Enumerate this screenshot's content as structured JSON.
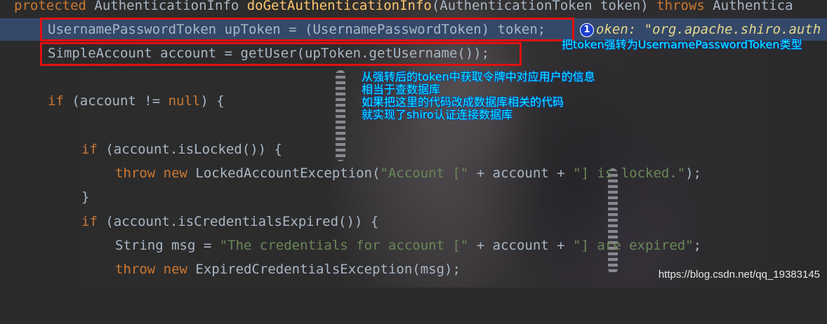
{
  "code": {
    "line0": {
      "kw": "protected",
      "type": " AuthenticationInfo ",
      "fn": "doGetAuthenticationInfo",
      "args": "(AuthenticationToken token) ",
      "throws": "throws",
      "rest": " Authentica"
    },
    "line1": {
      "text": "UsernamePasswordToken upToken = (UsernamePasswordToken) token;",
      "hint": "oken: \"org.apache.shiro.auth"
    },
    "line2": {
      "text": "SimpleAccount account = getUser(upToken.getUsername());"
    },
    "line4": {
      "kw": "if",
      "rest1": " (account != ",
      "kw2": "null",
      "rest2": ") {"
    },
    "line6": {
      "kw": "if",
      "rest": " (account.isLocked()) {"
    },
    "line7": {
      "kw1": "throw",
      "kw2": " new",
      "cls": " LockedAccountException(",
      "str1": "\"Account [\"",
      "mid": " + account + ",
      "str2": "\"] is locked.\"",
      "end": ");"
    },
    "line8": {
      "text": "}"
    },
    "line9": {
      "kw": "if",
      "rest": " (account.isCredentialsExpired()) {"
    },
    "line10": {
      "type": "String msg = ",
      "str1": "\"The credentials for account [\"",
      "mid": " + account + ",
      "str2": "\"] are expired\"",
      "end": ";"
    },
    "line11": {
      "kw1": "throw",
      "kw2": " new",
      "cls": " ExpiredCredentialsException(msg);"
    }
  },
  "badge": "1",
  "annotations": {
    "cast_note": "把token强转为UsernamePasswordToken类型",
    "explain": [
      "从强转后的token中获取令牌中对应用户的信息",
      "相当于查数据库",
      "如果把这里的代码改成数据库相关的代码",
      "就实现了shiro认证连接数据库"
    ]
  },
  "watermark": "https://blog.csdn.net/qq_19383145",
  "colors": {
    "keyword": "#cc7832",
    "function": "#ffc66d",
    "string": "#6a8759",
    "text": "#a9b7c6",
    "highlight": "#34496a",
    "box": "#e01010",
    "annotation": "#00f0ff"
  }
}
